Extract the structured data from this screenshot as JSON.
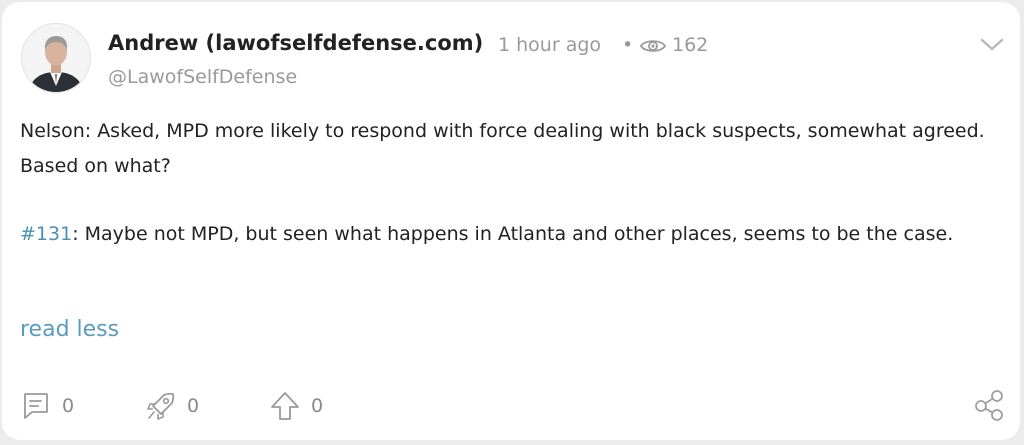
{
  "post": {
    "author_name": "Andrew (lawofselfdefense.com)",
    "time": "1 hour ago",
    "separator": "•",
    "views": "162",
    "handle": "@LawofSelfDefense",
    "paragraph1": "Nelson: Asked, MPD more likely to respond with force dealing with black suspects, somewhat agreed. Based on what?",
    "hashtag": "#131",
    "paragraph2_rest": ": Maybe not MPD, but seen what happens in Atlanta and other places, seems to be the case.",
    "read_less": "read less"
  },
  "actions": {
    "replies": "0",
    "reposts": "0",
    "upvotes": "0"
  },
  "icons": {
    "avatar": "avatar-photo",
    "views": "eye-icon",
    "menu": "chevron-down-icon",
    "reply": "comment-icon",
    "repost": "rocket-icon",
    "upvote": "arrow-up-icon",
    "share": "share-icon"
  },
  "colors": {
    "link": "#4c8fb3",
    "muted": "#9a9a9a",
    "background": "#ececec",
    "card": "#ffffff"
  }
}
